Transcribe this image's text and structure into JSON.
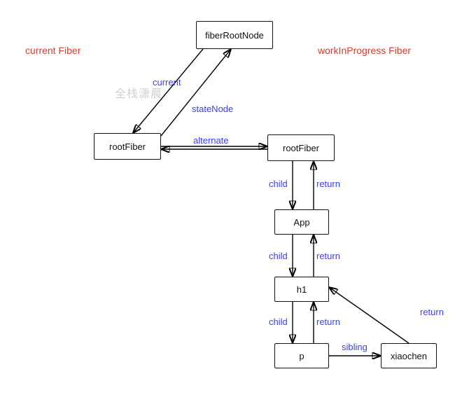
{
  "titles": {
    "left": "current Fiber",
    "right": "workInProgress Fiber"
  },
  "watermark": "全栈潇晨",
  "nodes": {
    "fiberRootNode": "fiberRootNode",
    "rootFiberLeft": "rootFiber",
    "rootFiberRight": "rootFiber",
    "app": "App",
    "h1": "h1",
    "p": "p",
    "xiaochen": "xiaochen"
  },
  "edges": {
    "current": "current",
    "stateNode": "stateNode",
    "alternate": "alternate",
    "child": "child",
    "return": "return",
    "sibling": "sibling"
  }
}
